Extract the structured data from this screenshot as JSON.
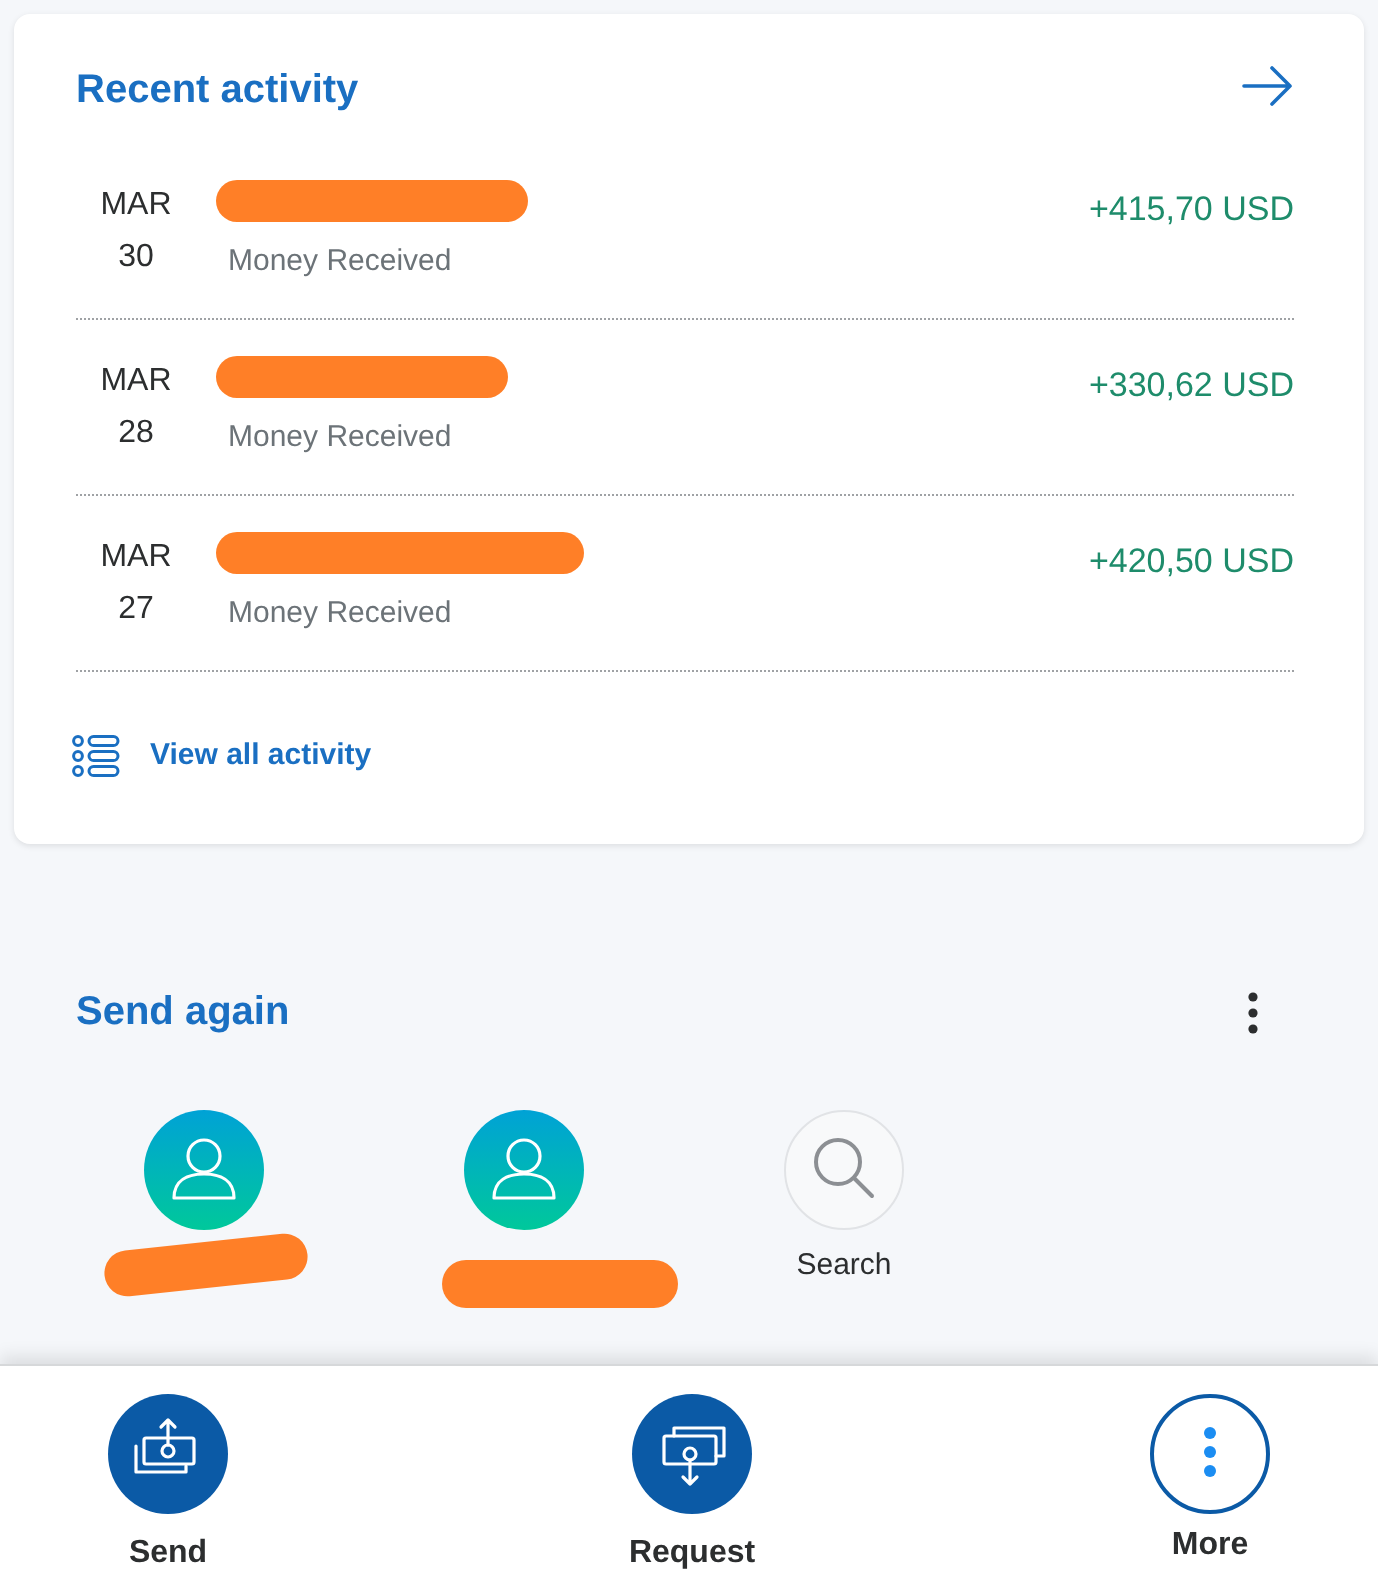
{
  "recent_activity": {
    "title": "Recent activity",
    "transactions": [
      {
        "month": "MAR",
        "day": "30",
        "name_redacted": true,
        "description": "Money Received",
        "amount": "+415,70 USD"
      },
      {
        "month": "MAR",
        "day": "28",
        "name_redacted": true,
        "description": "Money Received",
        "amount": "+330,62 USD"
      },
      {
        "month": "MAR",
        "day": "27",
        "name_redacted": true,
        "description": "Money Received",
        "amount": "+420,50 USD"
      }
    ],
    "view_all_link": "View all activity"
  },
  "send_again": {
    "title": "Send again",
    "contacts": [
      {
        "kind": "person",
        "name_redacted": true
      },
      {
        "kind": "person",
        "name_redacted": true
      },
      {
        "kind": "search",
        "label": "Search"
      }
    ]
  },
  "bottom_nav": [
    {
      "kind": "send",
      "label": "Send"
    },
    {
      "kind": "request",
      "label": "Request"
    },
    {
      "kind": "more",
      "label": "More"
    }
  ]
}
